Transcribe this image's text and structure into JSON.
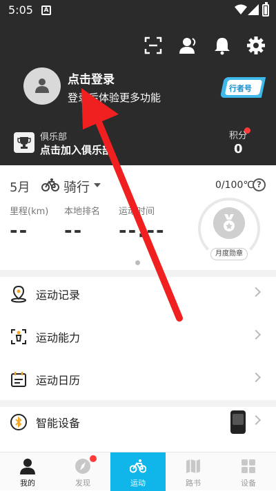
{
  "status_bar": {
    "time": "5:05",
    "sim": "A"
  },
  "header": {
    "login_title": "点击登录",
    "login_subtitle": "登录后体验更多功能",
    "rider_badge": "行者号",
    "club_title": "俱乐部",
    "club_join": "点击加入俱乐部",
    "points_label": "积分",
    "points_value": "0"
  },
  "stats": {
    "month": "5月",
    "sport": "骑行",
    "progress": "0/100℃",
    "help": "?",
    "items": [
      {
        "label": "里程(km)",
        "value": "--"
      },
      {
        "label": "本地排名",
        "value": "--"
      },
      {
        "label": "运动时间",
        "value": "--:--"
      }
    ],
    "medal_label": "月度勋章"
  },
  "menu": [
    {
      "label": "运动记录",
      "icon": "location-pin-icon"
    },
    {
      "label": "运动能力",
      "icon": "person-ability-icon"
    },
    {
      "label": "运动日历",
      "icon": "calendar-icon"
    },
    {
      "label": "智能设备",
      "icon": "bluetooth-icon"
    }
  ],
  "bottom_nav": [
    {
      "label": "我的",
      "icon": "profile-icon"
    },
    {
      "label": "发现",
      "icon": "compass-icon"
    },
    {
      "label": "运动",
      "icon": "bike-icon"
    },
    {
      "label": "路书",
      "icon": "map-icon"
    },
    {
      "label": "设备",
      "icon": "grid-icon"
    }
  ],
  "colors": {
    "header_bg": "#2b2b2b",
    "accent": "#10b5ea",
    "badge_red": "#ff3b3b",
    "annotation_arrow": "#f02020"
  }
}
